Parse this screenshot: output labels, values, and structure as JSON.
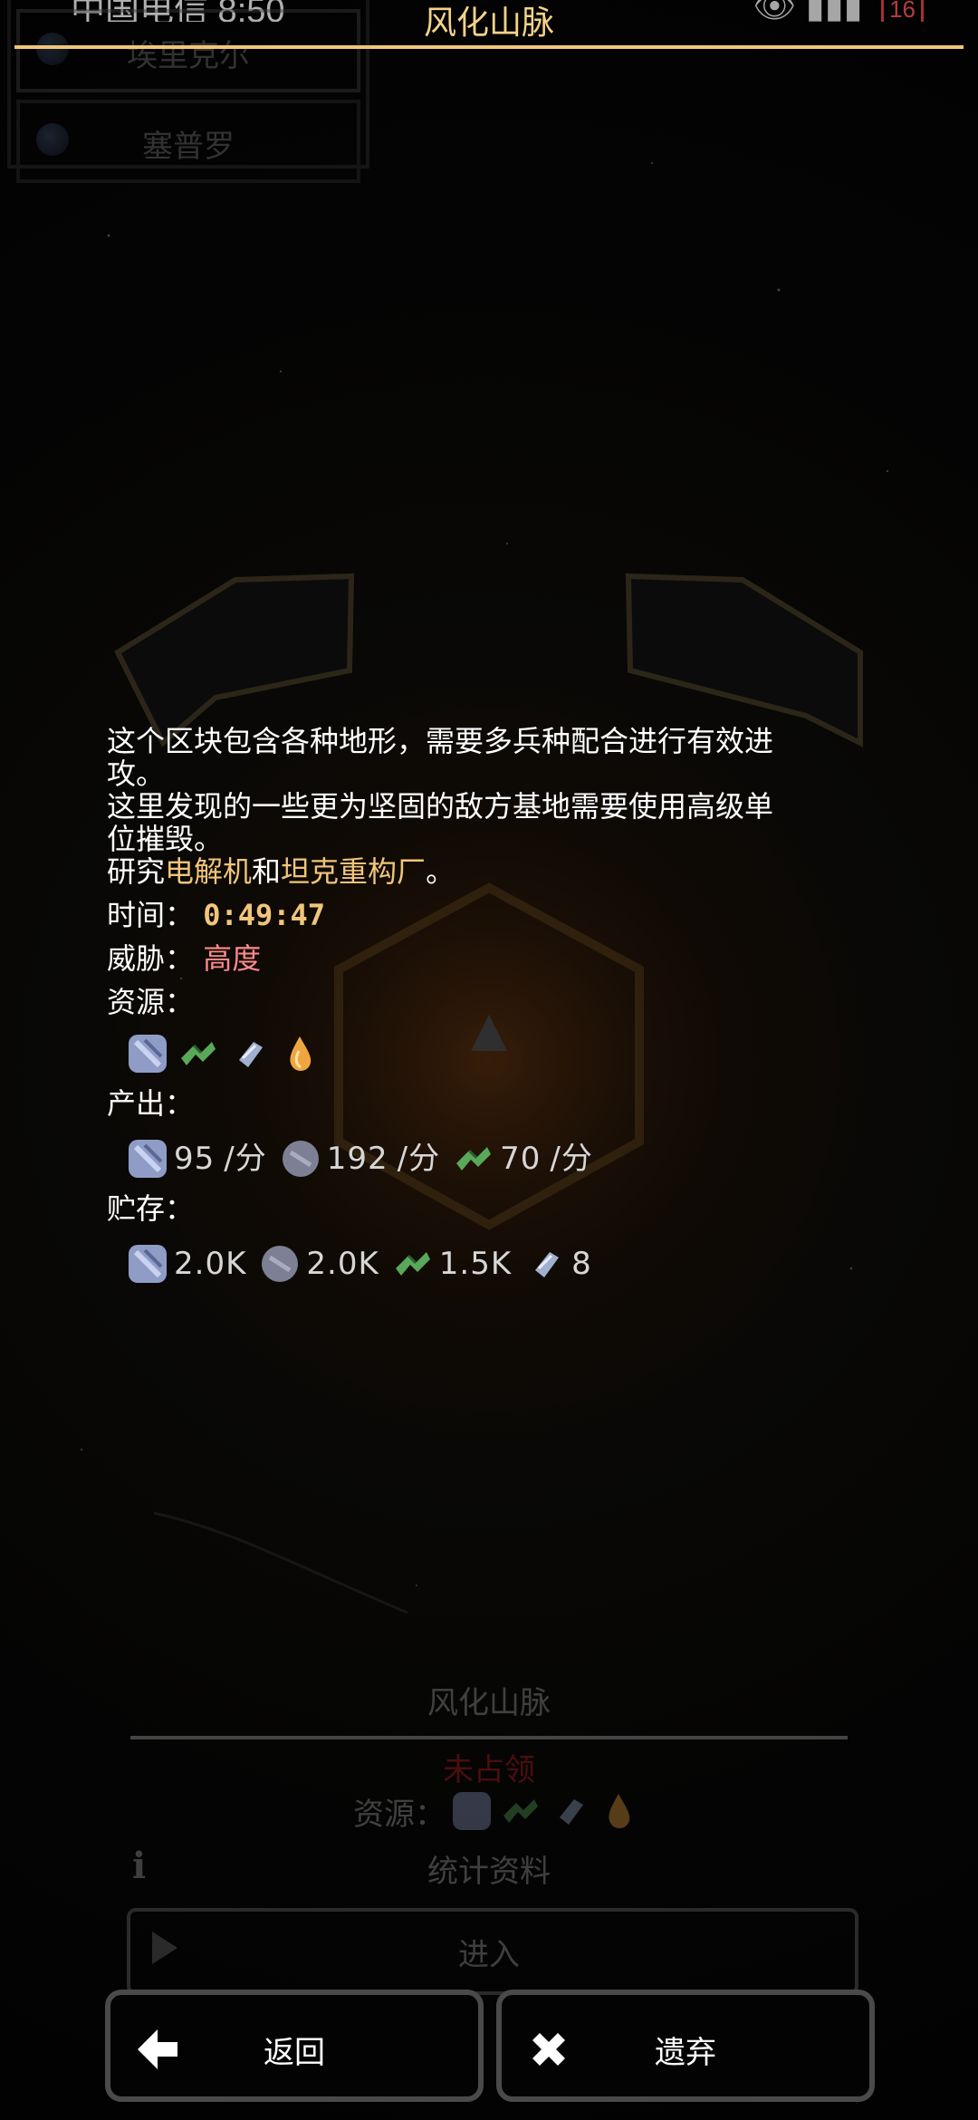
{
  "status_bar": {
    "carrier_time": "中国电信 8:50",
    "battery": "16"
  },
  "header": {
    "title": "风化山脉"
  },
  "planet_list": {
    "items": [
      "埃里克尔",
      "塞普罗"
    ]
  },
  "info": {
    "description_lines": [
      "这个区块包含各种地形，需要多兵种配合进行有效进",
      "攻。",
      "这里发现的一些更为坚固的敌方基地需要使用高级单",
      "位摧毁。"
    ],
    "research_prefix": "研究",
    "research_item1": "电解机",
    "research_mid": "和",
    "research_item2": "坦克重构厂",
    "research_suffix": "。",
    "time_label": "时间：",
    "time_value": "0:49:47",
    "threat_label": "威胁：",
    "threat_value": "高度",
    "resources_label": "资源：",
    "resources": [
      "copper-icon",
      "titanium-ore-icon",
      "scrap-icon",
      "oil-icon"
    ],
    "output_label": "产出：",
    "output": [
      {
        "icon": "copper-icon",
        "value": "95",
        "unit": "/分"
      },
      {
        "icon": "lead-icon",
        "value": "192",
        "unit": "/分"
      },
      {
        "icon": "titanium-icon",
        "value": "70",
        "unit": "/分"
      }
    ],
    "storage_label": "贮存：",
    "storage": [
      {
        "icon": "copper-icon",
        "value": "2.0K"
      },
      {
        "icon": "lead-icon",
        "value": "2.0K"
      },
      {
        "icon": "titanium-icon",
        "value": "1.5K"
      },
      {
        "icon": "scrap-icon",
        "value": "8"
      }
    ]
  },
  "dim_card": {
    "title": "风化山脉",
    "status": "未占领",
    "resources_label": "资源：",
    "stats_label": "统计资料",
    "enter_label": "进入"
  },
  "buttons": {
    "back_label": "返回",
    "abandon_label": "遗弃"
  },
  "colors": {
    "accent": "#f1c57a",
    "threat": "#ff8a8a"
  }
}
